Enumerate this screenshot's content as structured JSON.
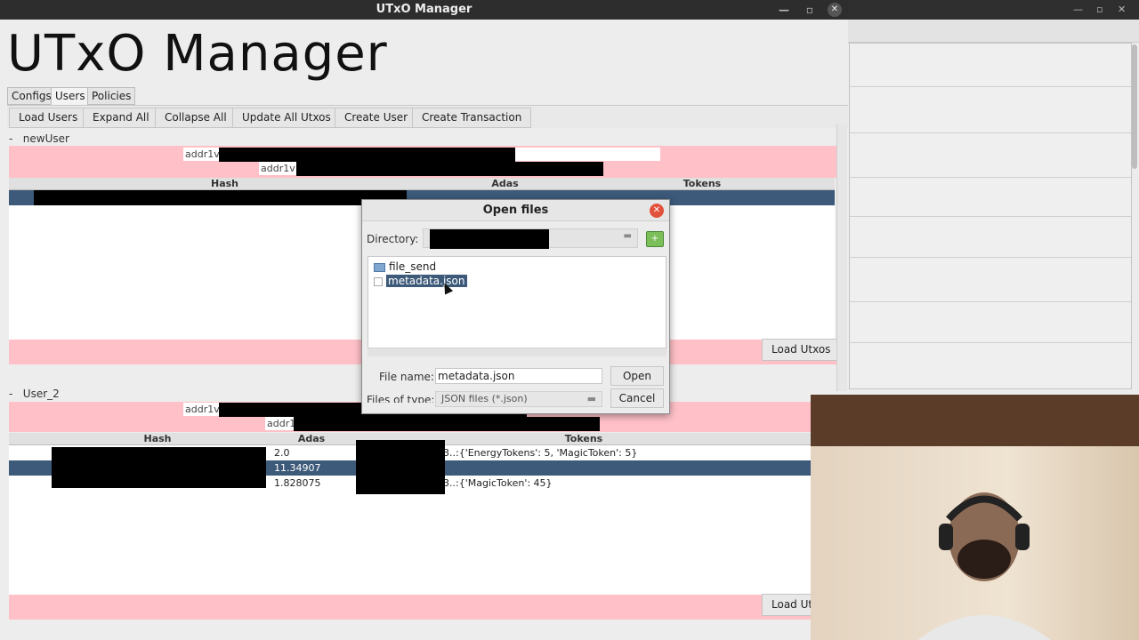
{
  "window": {
    "title": "UTxO Manager",
    "heading": "UTxO Manager"
  },
  "tabs": [
    "Configs",
    "Users",
    "Policies"
  ],
  "toolbar": [
    "Load Users",
    "Expand All",
    "Collapse All",
    "Update All Utxos",
    "Create User",
    "Create Transaction"
  ],
  "users": [
    {
      "name": "newUser",
      "addr_prefix_1": "addr1v",
      "addr_prefix_2": "addr1v",
      "columns": [
        "Hash",
        "Adas",
        "Tokens"
      ],
      "load_button": "Load Utxos"
    },
    {
      "name": "User_2",
      "addr_prefix_1": "addr1v",
      "addr_prefix_2": "addr1",
      "columns": [
        "Hash",
        "Adas",
        "Tokens"
      ],
      "rows": [
        {
          "adas": "2.0",
          "tokens": "3..:{'EnergyTokens': 5, 'MagicToken': 5}"
        },
        {
          "adas": "11.34907",
          "tokens": ""
        },
        {
          "adas": "1.828075",
          "tokens": "3..:{'MagicToken': 45}"
        }
      ],
      "load_button": "Load Ut:"
    }
  ],
  "dialog": {
    "title": "Open files",
    "directory_label": "Directory:",
    "files": [
      {
        "name": "file_send",
        "type": "folder"
      },
      {
        "name": "metadata.json",
        "type": "file",
        "selected": true
      }
    ],
    "file_name_label": "File name:",
    "file_name_value": "metadata.json",
    "files_of_type_label": "Files of type:",
    "files_of_type_value": "JSON files (*.json)",
    "open_button": "Open",
    "cancel_button": "Cancel"
  },
  "colors": {
    "highlight": "#3d5a7a",
    "pink_row": "#ffc0c8",
    "close_red": "#e2513b"
  }
}
